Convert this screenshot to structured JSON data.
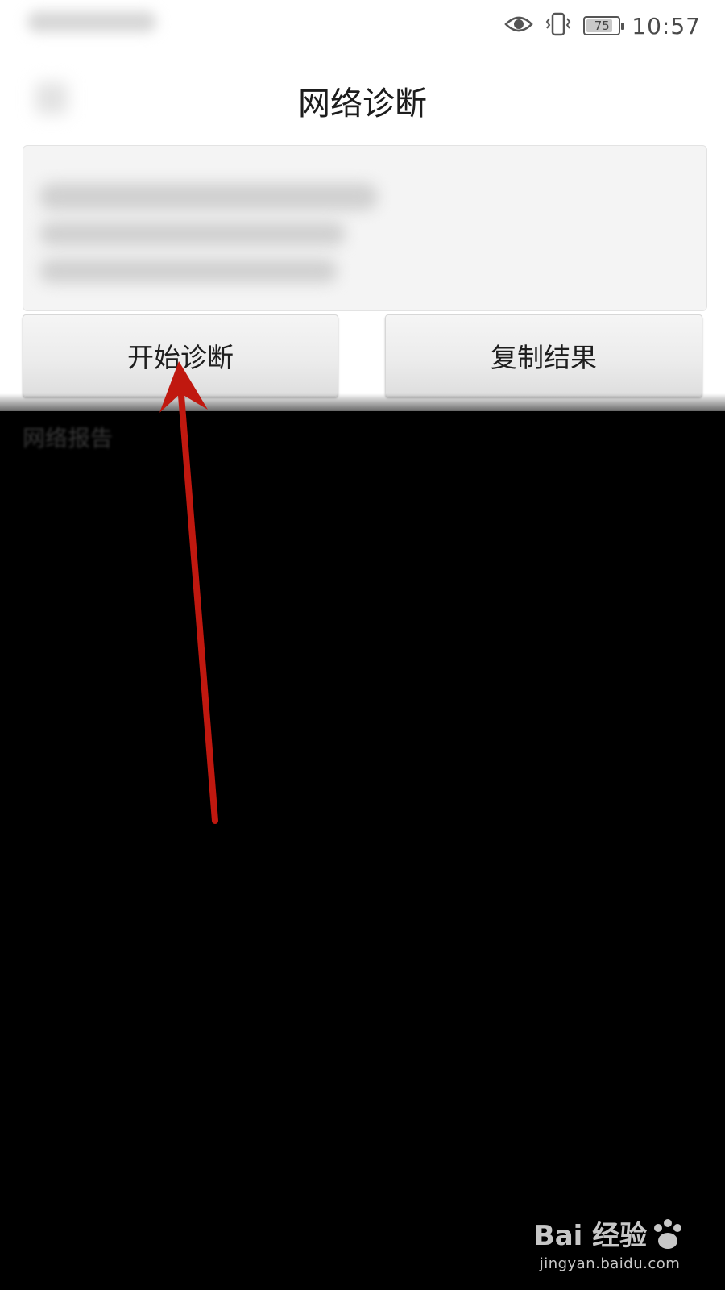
{
  "status_bar": {
    "time": "10:57",
    "battery_level": "75",
    "icons": [
      "eye-icon",
      "vibrate-icon",
      "battery-icon"
    ]
  },
  "header": {
    "title": "网络诊断"
  },
  "buttons": {
    "start_label": "开始诊断",
    "copy_label": "复制结果"
  },
  "below_text": "网络报告",
  "watermark": {
    "brand_text": "Bai 经验",
    "url": "jingyan.baidu.com"
  },
  "colors": {
    "arrow": "#c0180f",
    "background_dark": "#000000",
    "background_light": "#ffffff"
  }
}
